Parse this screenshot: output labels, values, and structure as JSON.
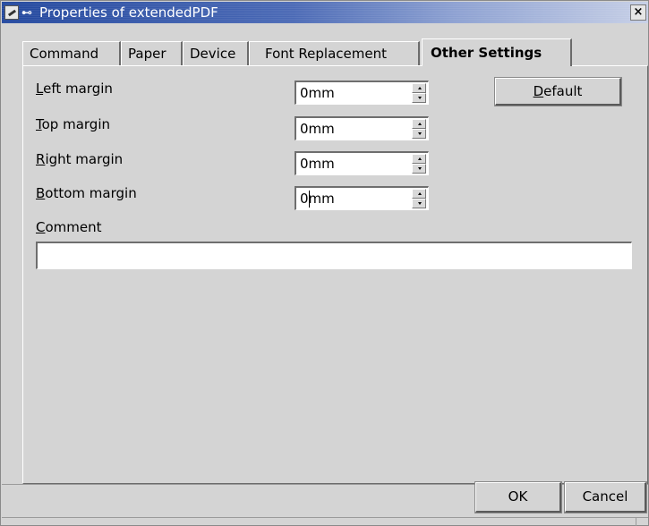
{
  "window": {
    "title": "Properties of extendedPDF",
    "close_glyph": "×",
    "pin_glyph": "⊷"
  },
  "tabs": [
    {
      "label": "Command",
      "active": false
    },
    {
      "label": "Paper",
      "active": false
    },
    {
      "label": "Device",
      "active": false
    },
    {
      "label": "Font Replacement",
      "active": false
    },
    {
      "label": "Other Settings",
      "active": true
    }
  ],
  "fields": {
    "left_margin": {
      "mnemonic": "L",
      "label_rest": "eft margin",
      "value": "0mm"
    },
    "top_margin": {
      "mnemonic": "T",
      "label_rest": "op margin",
      "value": "0mm"
    },
    "right_margin": {
      "mnemonic": "R",
      "label_rest": "ight margin",
      "value": "0mm"
    },
    "bottom_margin": {
      "mnemonic": "B",
      "label_rest": "ottom margin",
      "value": "0mm"
    },
    "comment": {
      "mnemonic": "C",
      "label_rest": "omment",
      "value": ""
    }
  },
  "buttons": {
    "default": {
      "mnemonic": "D",
      "label_rest": "efault"
    },
    "ok": "OK",
    "cancel": "Cancel"
  },
  "colors": {
    "titlebar_start": "#22479e",
    "titlebar_end": "#c6cfe6",
    "background": "#d4d4d4"
  }
}
